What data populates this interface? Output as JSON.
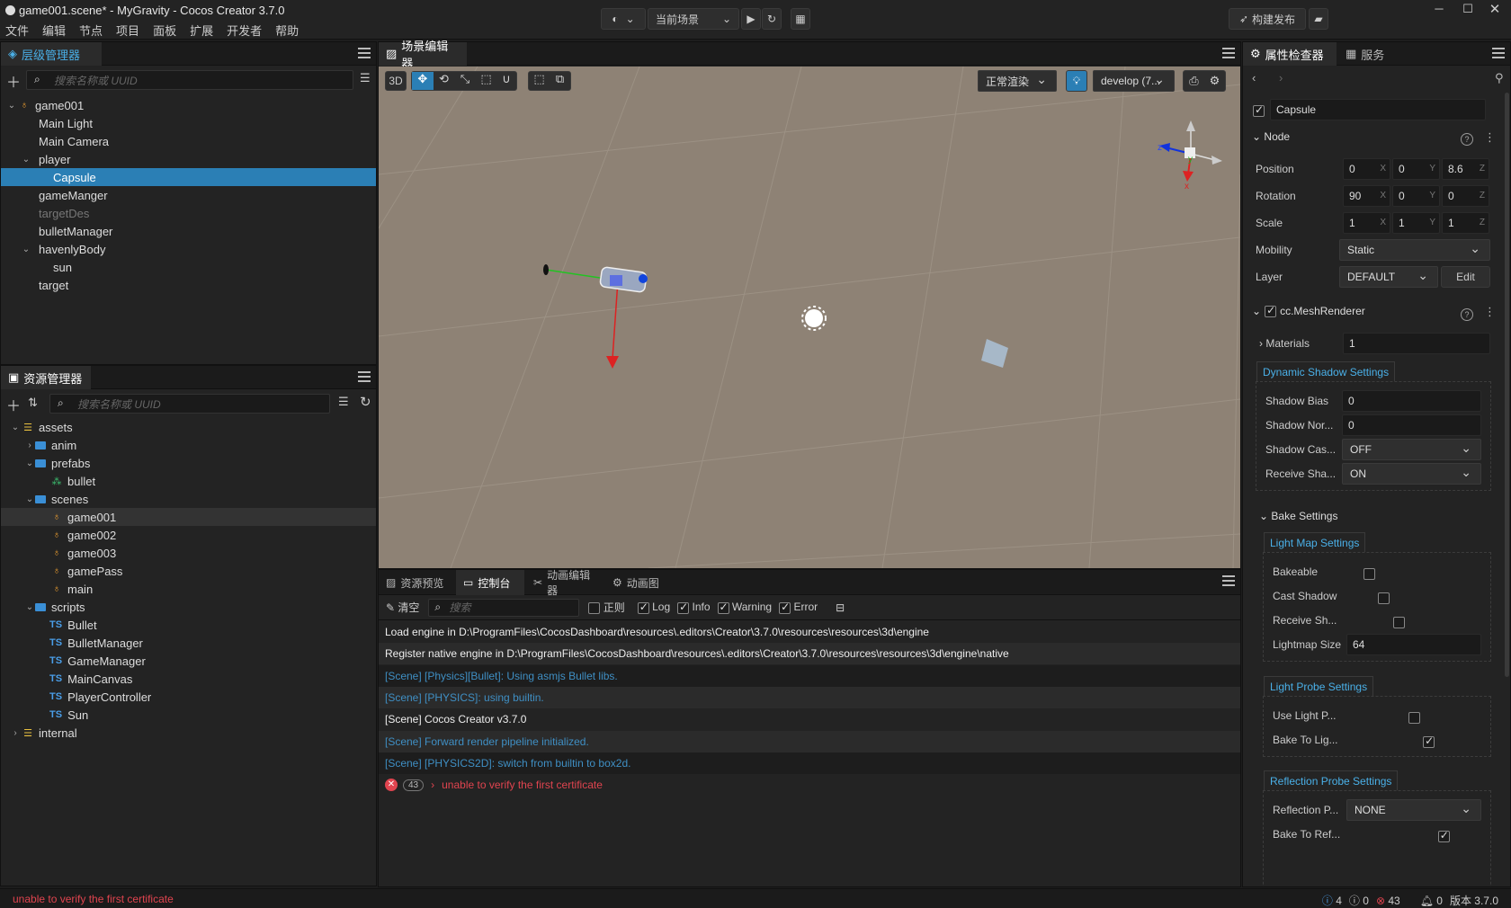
{
  "window": {
    "title": "game001.scene* - MyGravity - Cocos Creator 3.7.0"
  },
  "menu": [
    "文件",
    "编辑",
    "节点",
    "项目",
    "面板",
    "扩展",
    "开发者",
    "帮助"
  ],
  "toolbar": {
    "scene_select": "当前场景",
    "build_publish": "构建发布"
  },
  "hierarchy": {
    "tab": "层级管理器",
    "search_placeholder": "搜索名称或 UUID",
    "items": [
      {
        "label": "game001",
        "depth": 0,
        "arrow": "open",
        "fire": true
      },
      {
        "label": "Main Light",
        "depth": 1
      },
      {
        "label": "Main Camera",
        "depth": 1
      },
      {
        "label": "player",
        "depth": 1,
        "arrow": "open"
      },
      {
        "label": "Capsule",
        "depth": 2,
        "selected": true
      },
      {
        "label": "gameManger",
        "depth": 1
      },
      {
        "label": "targetDes",
        "depth": 1,
        "dim": true
      },
      {
        "label": "bulletManager",
        "depth": 1
      },
      {
        "label": "havenlyBody",
        "depth": 1,
        "arrow": "open"
      },
      {
        "label": "sun",
        "depth": 2
      },
      {
        "label": "target",
        "depth": 1
      }
    ]
  },
  "assets": {
    "tab": "资源管理器",
    "search_placeholder": "搜索名称或 UUID",
    "items": [
      {
        "label": "assets",
        "depth": 0,
        "arrow": "open",
        "type": "db"
      },
      {
        "label": "anim",
        "depth": 1,
        "arrow": "closed",
        "type": "folder"
      },
      {
        "label": "prefabs",
        "depth": 1,
        "arrow": "open",
        "type": "folder"
      },
      {
        "label": "bullet",
        "depth": 2,
        "type": "prefab"
      },
      {
        "label": "scenes",
        "depth": 1,
        "arrow": "open",
        "type": "folder"
      },
      {
        "label": "game001",
        "depth": 2,
        "type": "scene",
        "highlight": true
      },
      {
        "label": "game002",
        "depth": 2,
        "type": "scene"
      },
      {
        "label": "game003",
        "depth": 2,
        "type": "scene"
      },
      {
        "label": "gamePass",
        "depth": 2,
        "type": "scene"
      },
      {
        "label": "main",
        "depth": 2,
        "type": "scene"
      },
      {
        "label": "scripts",
        "depth": 1,
        "arrow": "open",
        "type": "folder"
      },
      {
        "label": "Bullet",
        "depth": 2,
        "type": "ts"
      },
      {
        "label": "BulletManager",
        "depth": 2,
        "type": "ts"
      },
      {
        "label": "GameManager",
        "depth": 2,
        "type": "ts"
      },
      {
        "label": "MainCanvas",
        "depth": 2,
        "type": "ts"
      },
      {
        "label": "PlayerController",
        "depth": 2,
        "type": "ts"
      },
      {
        "label": "Sun",
        "depth": 2,
        "type": "ts"
      },
      {
        "label": "internal",
        "depth": 0,
        "arrow": "closed",
        "type": "db"
      }
    ]
  },
  "scene": {
    "tab": "场景编辑器",
    "mode3d": "3D",
    "render_mode": "正常渲染",
    "camera": "develop (7...",
    "gizmo_x": "x",
    "gizmo_y": "y",
    "gizmo_z": "z"
  },
  "console": {
    "tabs": [
      "资源预览",
      "控制台",
      "动画编辑器",
      "动画图"
    ],
    "clear": "清空",
    "search_placeholder": "搜索",
    "regex": "正则",
    "log": "Log",
    "info": "Info",
    "warning": "Warning",
    "error": "Error",
    "lines": [
      {
        "text": "Load engine in D:\\ProgramFiles\\CocosDashboard\\resources\\.editors\\Creator\\3.7.0\\resources\\resources\\3d\\engine",
        "kind": "w"
      },
      {
        "text": "Register native engine in D:\\ProgramFiles\\CocosDashboard\\resources\\.editors\\Creator\\3.7.0\\resources\\resources\\3d\\engine\\native",
        "kind": "w"
      },
      {
        "text": "[Scene] [Physics][Bullet]: Using asmjs Bullet libs.",
        "kind": "b"
      },
      {
        "text": "[Scene] [PHYSICS]: using builtin.",
        "kind": "b"
      },
      {
        "text": "[Scene] Cocos Creator v3.7.0",
        "kind": "w"
      },
      {
        "text": "[Scene] Forward render pipeline initialized.",
        "kind": "b"
      },
      {
        "text": "[Scene] [PHYSICS2D]: switch from builtin to box2d.",
        "kind": "b"
      }
    ],
    "error_count": "43",
    "error_text": "unable to verify the first certificate"
  },
  "inspector": {
    "tabs": [
      "属性检查器",
      "服务"
    ],
    "node_name": "Capsule",
    "node_section": "Node",
    "position": {
      "label": "Position",
      "x": "0",
      "y": "0",
      "z": "8.6"
    },
    "rotation": {
      "label": "Rotation",
      "x": "90",
      "y": "0",
      "z": "0"
    },
    "scale": {
      "label": "Scale",
      "x": "1",
      "y": "1",
      "z": "1"
    },
    "mobility": {
      "label": "Mobility",
      "value": "Static"
    },
    "layer": {
      "label": "Layer",
      "value": "DEFAULT",
      "edit": "Edit"
    },
    "mesh_renderer": "cc.MeshRenderer",
    "materials": {
      "label": "Materials",
      "value": "1"
    },
    "dynamic_shadow": {
      "title": "Dynamic Shadow Settings",
      "bias_label": "Shadow Bias",
      "bias": "0",
      "normal_label": "Shadow Nor...",
      "normal": "0",
      "cast_label": "Shadow Cas...",
      "cast": "OFF",
      "receive_label": "Receive Sha...",
      "receive": "ON"
    },
    "bake": {
      "title": "Bake Settings"
    },
    "lightmap": {
      "title": "Light Map Settings",
      "bakeable": "Bakeable",
      "cast_shadow": "Cast Shadow",
      "receive_shadow": "Receive Sh...",
      "size_label": "Lightmap Size",
      "size": "64"
    },
    "light_probe": {
      "title": "Light Probe Settings",
      "use_label": "Use Light P...",
      "bake_label": "Bake To Lig..."
    },
    "reflection_probe": {
      "title": "Reflection Probe Settings",
      "probe_label": "Reflection P...",
      "probe": "NONE",
      "bake_label": "Bake To Ref..."
    }
  },
  "status": {
    "message": "unable to verify the first certificate",
    "info": "4",
    "warn": "0",
    "error": "43",
    "notify": "0",
    "version": "版本 3.7.0"
  },
  "colors": {
    "accent": "#2b7fb5",
    "link": "#4ab0e8",
    "error": "#e0444f"
  }
}
